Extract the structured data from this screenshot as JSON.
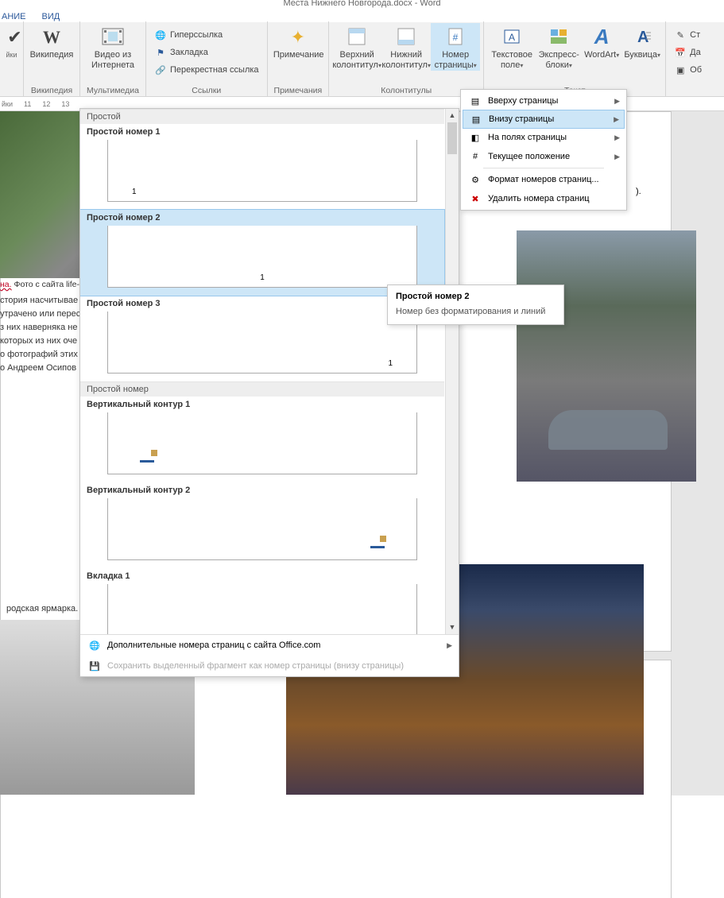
{
  "window": {
    "title": "Места Нижнего Новгорода.docx - Word"
  },
  "tabs": {
    "t1": "АНИЕ",
    "t2": "ВИД"
  },
  "ribbon": {
    "prov": {
      "label": "йки"
    },
    "wiki": {
      "btn": "Википедия",
      "group": "Википедия"
    },
    "video": {
      "btn": "Видео из\nИнтернета",
      "group": "Мультимедиа"
    },
    "links": {
      "hyper": "Гиперссылка",
      "bookmark": "Закладка",
      "xref": "Перекрестная ссылка",
      "group": "Ссылки"
    },
    "note": {
      "btn": "Примечание",
      "group": "Примечания"
    },
    "hf": {
      "hdr": "Верхний\nколонтитул",
      "ftr": "Нижний\nколонтитул",
      "pn": "Номер\nстраницы",
      "group": "Колонтитулы"
    },
    "text": {
      "tb": "Текстовое\nполе",
      "qp": "Экспресс-\nблоки",
      "wa": "WordArt",
      "dc": "Буквица",
      "group": "Текст"
    },
    "right": {
      "sig": "Ст",
      "date": "Да",
      "obj": "Об"
    }
  },
  "ruler": [
    "йки",
    "11",
    "12",
    "13"
  ],
  "doc": {
    "cap1_red": "на.",
    "cap1": " Фото с сайта life-p",
    "body": "стория насчитывае\nутрачено или перес\nз них наверняка не\nкоторых из них оче\nо фотографий этих\nо Андреем Осипов",
    "cap2": "родская ярмарка.",
    "text_near_img2": ")."
  },
  "pnmenu": {
    "i1": "Вверху страницы",
    "i2": "Внизу страницы",
    "i3": "На полях страницы",
    "i4": "Текущее положение",
    "i5": "Формат номеров страниц...",
    "i6": "Удалить номера страниц"
  },
  "gallery": {
    "hdr1": "Простой",
    "g1": "Простой номер 1",
    "g2": "Простой номер 2",
    "g3": "Простой номер 3",
    "hdr2": "Простой номер",
    "g4": "Вертикальный контур 1",
    "g5": "Вертикальный контур 2",
    "g6": "Вкладка 1",
    "more": "Дополнительные номера страниц с сайта Office.com",
    "save": "Сохранить выделенный фрагмент как номер страницы (внизу страницы)"
  },
  "tooltip": {
    "title": "Простой номер 2",
    "body": "Номер без форматирования и линий"
  }
}
